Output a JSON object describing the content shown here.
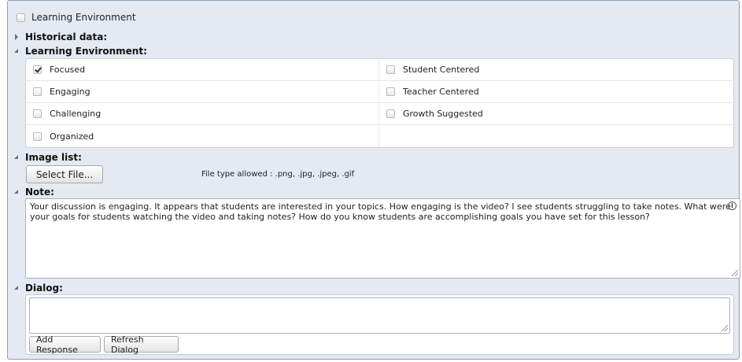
{
  "header": {
    "checkbox_label": "Learning Environment",
    "checked": false
  },
  "sections": {
    "historical": {
      "title": "Historical data:"
    },
    "learning": {
      "title": "Learning Environment:"
    },
    "image_list": {
      "title": "Image list:"
    },
    "note": {
      "title": "Note:"
    },
    "dialog": {
      "title": "Dialog:"
    }
  },
  "learning_options": [
    {
      "label": "Focused",
      "checked": true
    },
    {
      "label": "Student Centered",
      "checked": false
    },
    {
      "label": "Engaging",
      "checked": false
    },
    {
      "label": "Teacher Centered",
      "checked": false
    },
    {
      "label": "Challenging",
      "checked": false
    },
    {
      "label": "Growth Suggested",
      "checked": false
    },
    {
      "label": "Organized",
      "checked": false
    }
  ],
  "image_list": {
    "select_button": "Select File...",
    "file_types": "File type allowed : .png, .jpg, .jpeg, .gif"
  },
  "note": {
    "text": "Your discussion is engaging. It appears that students are interested in your topics. How engaging is the video? I see students struggling to take notes. What were your goals for students watching the video and taking notes? How do you know students are accomplishing goals you have set for this lesson?",
    "info_icon": "info-icon"
  },
  "dialog": {
    "value": "",
    "add_response": "Add Response",
    "refresh_dialog": "Refresh Dialog"
  }
}
